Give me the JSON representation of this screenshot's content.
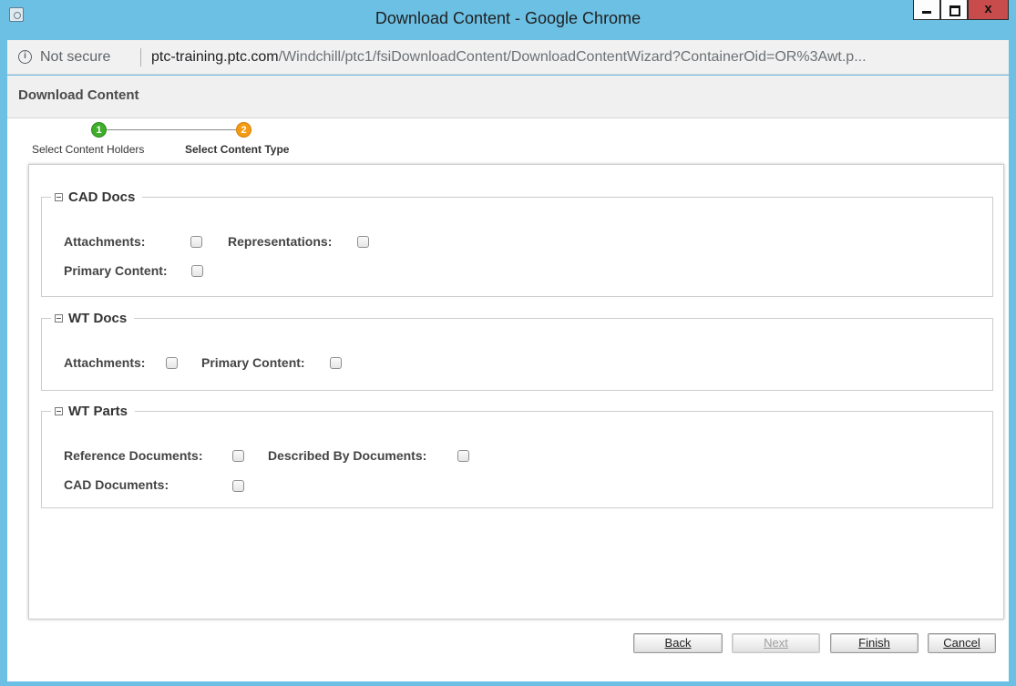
{
  "window": {
    "title": "Download Content - Google Chrome",
    "controls": {
      "minimize": "–",
      "maximize": "□",
      "close": "x"
    }
  },
  "address_bar": {
    "security_text": "Not secure",
    "url_host": "ptc-training.ptc.com",
    "url_path": "/Windchill/ptc1/fsiDownloadContent/DownloadContentWizard?ContainerOid=OR%3Awt.p..."
  },
  "page": {
    "header": "Download Content"
  },
  "wizard": {
    "steps": [
      {
        "number": "1",
        "label": "Select Content Holders",
        "status": "complete",
        "color": "#3fae2a"
      },
      {
        "number": "2",
        "label": "Select Content Type",
        "status": "current",
        "color": "#f59b12"
      }
    ]
  },
  "groups": {
    "cad_docs": {
      "title": "CAD Docs",
      "attachments": "Attachments:",
      "representations": "Representations:",
      "primary_content": "Primary Content:"
    },
    "wt_docs": {
      "title": "WT Docs",
      "attachments": "Attachments:",
      "primary_content": "Primary Content:"
    },
    "wt_parts": {
      "title": "WT Parts",
      "reference_documents": "Reference Documents:",
      "described_by_documents": "Described By Documents:",
      "cad_documents": "CAD Documents:"
    }
  },
  "buttons": {
    "back": "Back",
    "next": "Next",
    "finish": "Finish",
    "cancel": "Cancel"
  }
}
